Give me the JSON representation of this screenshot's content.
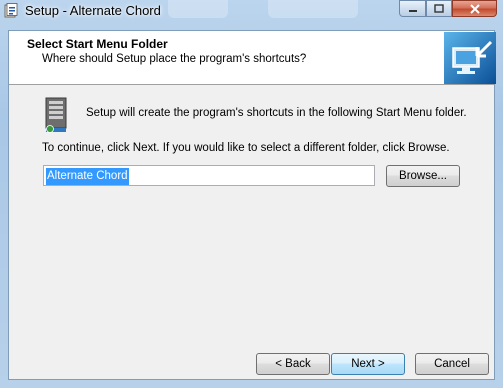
{
  "window": {
    "title": "Setup - Alternate Chord",
    "controls": {
      "minimize": "minimize",
      "maximize": "maximize",
      "close": "close"
    }
  },
  "header": {
    "title": "Select Start Menu Folder",
    "subtitle": "Where should Setup place the program's shortcuts?"
  },
  "content": {
    "info_text": "Setup will create the program's shortcuts in the following Start Menu folder.",
    "instruction_text": "To continue, click Next. If you would like to select a different folder, click Browse.",
    "folder_value": "Alternate Chord"
  },
  "buttons": {
    "browse": "Browse...",
    "back": "< Back",
    "next": "Next >",
    "cancel": "Cancel"
  },
  "colors": {
    "selection": "#3399ff",
    "frame": "#bcd5ee",
    "close_button": "#c44b2e"
  },
  "icons": [
    "setup-app-icon",
    "minimize-icon",
    "maximize-icon",
    "close-icon",
    "wizard-computer-icon",
    "start-menu-folder-icon"
  ]
}
